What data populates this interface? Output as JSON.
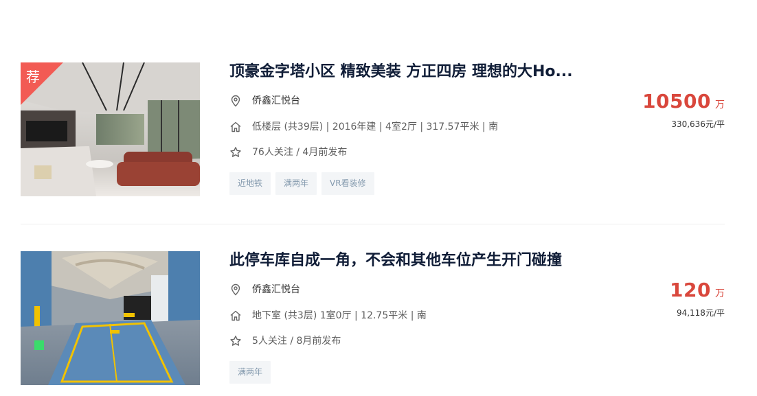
{
  "listings": [
    {
      "recommend_badge": "荐",
      "title": "顶豪金字塔小区 精致美装 方正四房 理想的大Ho...",
      "community": "侨鑫汇悦台",
      "house_info": "低楼层 (共39层) | 2016年建 | 4室2厅 | 317.57平米 | 南",
      "follow_info": "76人关注 / 4月前发布",
      "tags": [
        "近地铁",
        "满两年",
        "VR看装修"
      ],
      "total_price": "10500",
      "price_unit": "万",
      "unit_price": "330,636元/平"
    },
    {
      "title": "此停车库自成一角，不会和其他车位产生开门碰撞",
      "community": "侨鑫汇悦台",
      "house_info": "地下室 (共3层) 1室0厅 | 12.75平米 | 南",
      "follow_info": "5人关注 / 8月前发布",
      "tags": [
        "满两年"
      ],
      "total_price": "120",
      "price_unit": "万",
      "unit_price": "94,118元/平"
    }
  ],
  "icons": {
    "location": "location-pin-icon",
    "house": "house-icon",
    "star": "star-icon"
  },
  "colors": {
    "price": "#d9473c",
    "title": "#101d37",
    "tag_bg": "#f3f5f7",
    "tag_text": "#849aae",
    "badge": "#f25b54"
  }
}
